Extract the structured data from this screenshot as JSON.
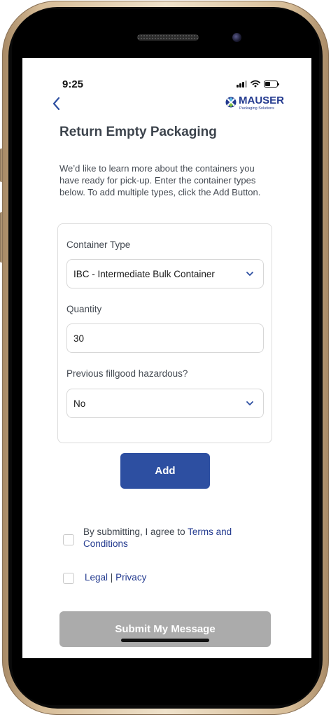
{
  "status_bar": {
    "time": "9:25"
  },
  "header": {
    "back_icon": "chevron-left-icon",
    "logo_name": "MAUSER",
    "logo_subtitle": "Packaging Solutions"
  },
  "page": {
    "title": "Return Empty Packaging",
    "intro": "We’d like to learn more about the containers you have ready for pick-up. Enter the container types below. To add multiple types, click the Add Button."
  },
  "form": {
    "container_type": {
      "label": "Container Type",
      "value": "IBC - Intermediate Bulk Container"
    },
    "quantity": {
      "label": "Quantity",
      "value": "30"
    },
    "hazardous": {
      "label": "Previous fillgood hazardous?",
      "value": "No"
    },
    "add_label": "Add"
  },
  "consent": {
    "text": "By submitting, I agree to ",
    "terms_link": "Terms and Conditions",
    "legal_link": "Legal",
    "separator": " | ",
    "privacy_link": "Privacy"
  },
  "submit_label": "Submit My Message",
  "colors": {
    "accent": "#2d4fa1",
    "brand": "#233a8f",
    "disabled": "#ababab"
  }
}
